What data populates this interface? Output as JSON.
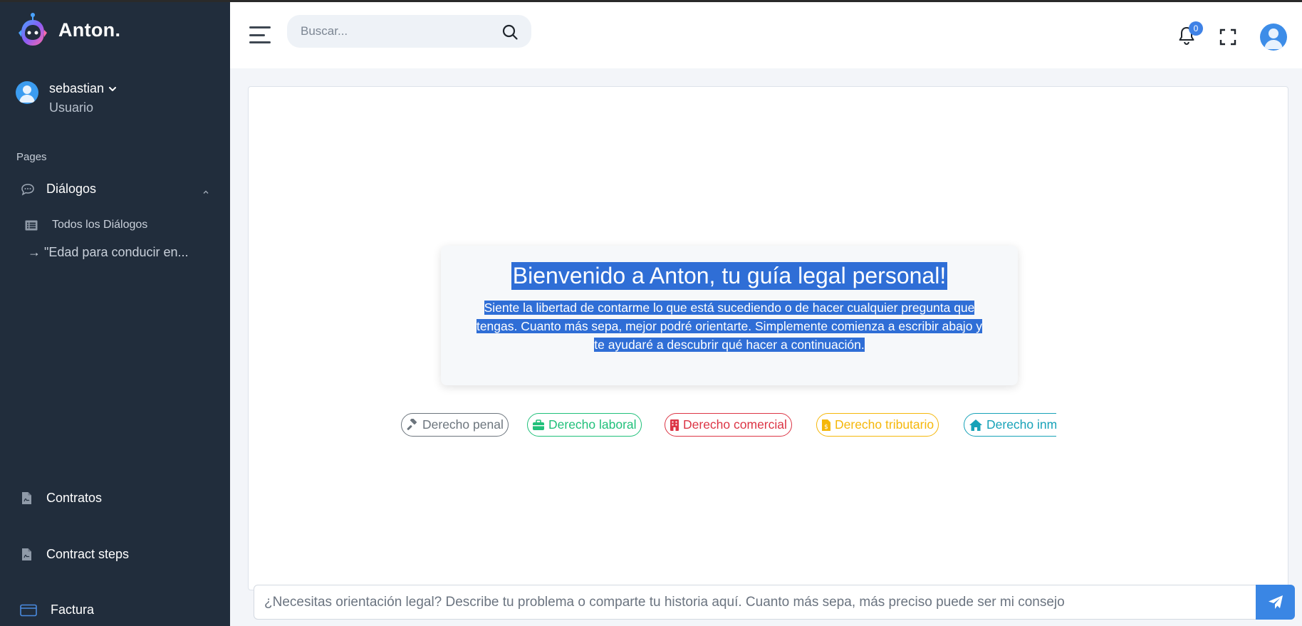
{
  "app": {
    "brand": "Anton."
  },
  "user": {
    "name": "sebastian",
    "role": "Usuario"
  },
  "sidebar": {
    "section_label": "Pages",
    "dialogs": {
      "label": "Diálogos",
      "items": [
        {
          "label": "Todos los Diálogos"
        },
        {
          "label": "→ \"Edad para conducir en..."
        }
      ]
    },
    "contracts": {
      "label": "Contratos"
    },
    "contract_steps": {
      "label": "Contract steps"
    },
    "invoice": {
      "label": "Factura"
    }
  },
  "header": {
    "search_placeholder": "Buscar...",
    "notifications_count": "0"
  },
  "welcome": {
    "title": "Bienvenido a Anton, tu guía legal personal!",
    "lines": [
      "Siente la libertad de contarme lo que está sucediendo o de hacer cualquier pregunta que",
      "tengas. Cuanto más sepa, mejor podré orientarte. Simplemente comienza a escribir abajo y",
      "te ayudaré a descubrir qué hacer a continuación."
    ]
  },
  "categories": [
    {
      "label": "Derecho penal",
      "icon": "gavel-icon",
      "color": "#6c757d"
    },
    {
      "label": "Derecho laboral",
      "icon": "briefcase-icon",
      "color": "#20c07a"
    },
    {
      "label": "Derecho comercial",
      "icon": "building-icon",
      "color": "#dc3545"
    },
    {
      "label": "Derecho tributario",
      "icon": "receipt-icon",
      "color": "#f5b70a"
    },
    {
      "label": "Derecho inmobiliario",
      "icon": "home-icon",
      "color": "#17a2b8"
    }
  ],
  "composer": {
    "placeholder": "¿Necesitas orientación legal? Describe tu problema o comparte tu historia aquí. Cuanto más sepa, más preciso puede ser mi consejo"
  },
  "colors": {
    "sidebar_bg": "#212d3c",
    "accent": "#3a86e4",
    "selection": "#2f6ed6"
  }
}
